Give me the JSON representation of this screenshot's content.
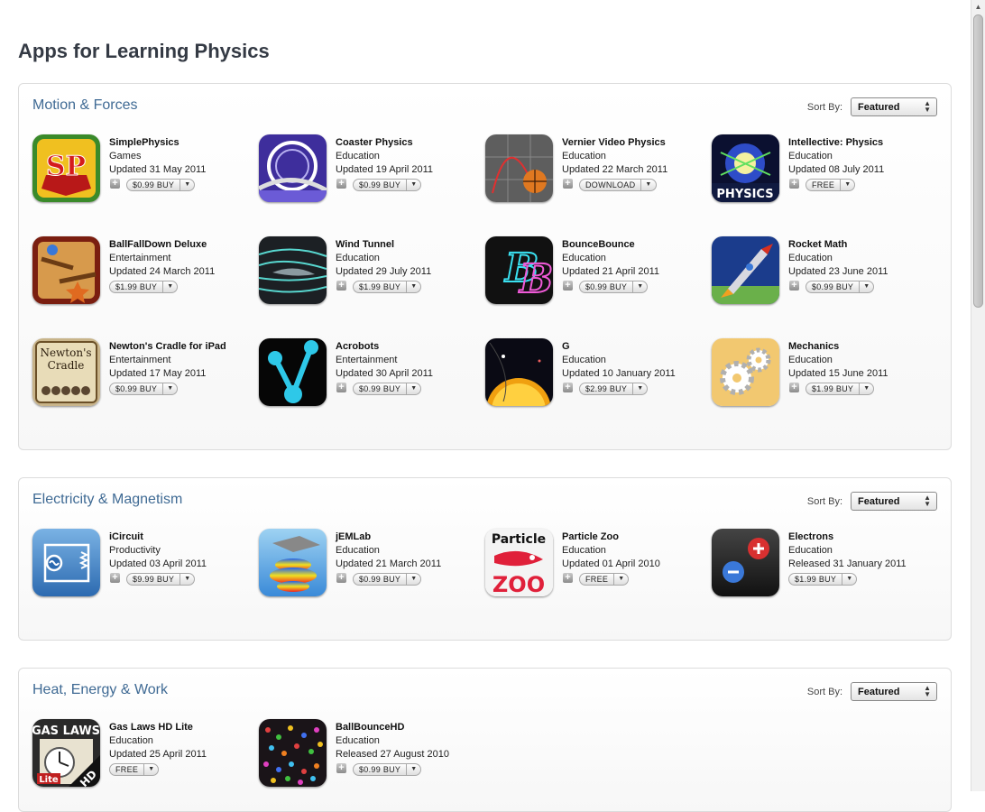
{
  "page_title": "Apps for Learning Physics",
  "sort_label": "Sort By:",
  "sort_value": "Featured",
  "sections": [
    {
      "title": "Motion & Forces",
      "apps": [
        {
          "name": "SimplePhysics",
          "category": "Games",
          "date": "Updated 31 May 2011",
          "price": "$0.99",
          "action": "BUY",
          "icon": "simplephysics-icon"
        },
        {
          "name": "Coaster Physics",
          "category": "Education",
          "date": "Updated 19 April 2011",
          "price": "$0.99",
          "action": "BUY",
          "icon": "coaster-physics-icon"
        },
        {
          "name": "Vernier Video Physics",
          "category": "Education",
          "date": "Updated 22 March 2011",
          "price": "",
          "action": "DOWNLOAD",
          "icon": "vernier-video-physics-icon"
        },
        {
          "name": "Intellective: Physics",
          "category": "Education",
          "date": "Updated 08 July 2011",
          "price": "",
          "action": "FREE",
          "icon": "intellective-physics-icon"
        },
        {
          "name": "BallFallDown Deluxe",
          "category": "Entertainment",
          "date": "Updated 24 March 2011",
          "price": "$1.99",
          "action": "BUY",
          "icon": "ballfalldown-icon"
        },
        {
          "name": "Wind Tunnel",
          "category": "Education",
          "date": "Updated 29 July 2011",
          "price": "$1.99",
          "action": "BUY",
          "icon": "wind-tunnel-icon"
        },
        {
          "name": "BounceBounce",
          "category": "Education",
          "date": "Updated 21 April 2011",
          "price": "$0.99",
          "action": "BUY",
          "icon": "bouncebounce-icon"
        },
        {
          "name": "Rocket Math",
          "category": "Education",
          "date": "Updated 23 June 2011",
          "price": "$0.99",
          "action": "BUY",
          "icon": "rocket-math-icon"
        },
        {
          "name": "Newton's Cradle for iPad",
          "category": "Entertainment",
          "date": "Updated 17 May 2011",
          "price": "$0.99",
          "action": "BUY",
          "icon": "newtons-cradle-icon"
        },
        {
          "name": "Acrobots",
          "category": "Entertainment",
          "date": "Updated 30 April 2011",
          "price": "$0.99",
          "action": "BUY",
          "icon": "acrobots-icon"
        },
        {
          "name": "G",
          "category": "Education",
          "date": "Updated 10 January 2011",
          "price": "$2.99",
          "action": "BUY",
          "icon": "g-app-icon"
        },
        {
          "name": "Mechanics",
          "category": "Education",
          "date": "Updated 15 June 2011",
          "price": "$1.99",
          "action": "BUY",
          "icon": "mechanics-gears-icon"
        }
      ]
    },
    {
      "title": "Electricity & Magnetism",
      "apps": [
        {
          "name": "iCircuit",
          "category": "Productivity",
          "date": "Updated 03 April 2011",
          "price": "$9.99",
          "action": "BUY",
          "icon": "icircuit-icon"
        },
        {
          "name": "jEMLab",
          "category": "Education",
          "date": "Updated 21 March 2011",
          "price": "$0.99",
          "action": "BUY",
          "icon": "jemlab-icon"
        },
        {
          "name": "Particle Zoo",
          "category": "Education",
          "date": "Updated 01 April 2010",
          "price": "",
          "action": "FREE",
          "icon": "particle-zoo-icon"
        },
        {
          "name": "Electrons",
          "category": "Education",
          "date": "Released 31 January 2011",
          "price": "$1.99",
          "action": "BUY",
          "icon": "electrons-icon"
        }
      ]
    },
    {
      "title": "Heat, Energy & Work",
      "apps": [
        {
          "name": "Gas Laws HD Lite",
          "category": "Education",
          "date": "Updated 25 April 2011",
          "price": "",
          "action": "FREE",
          "icon": "gas-laws-icon"
        },
        {
          "name": "BallBounceHD",
          "category": "Education",
          "date": "Released 27 August 2010",
          "price": "$0.99",
          "action": "BUY",
          "icon": "ballbounce-icon"
        }
      ]
    }
  ],
  "icon_text": {
    "simplephysics": "SP",
    "intellective": "PHYSICS",
    "newtons_cradle_line1": "Newton's",
    "newtons_cradle_line2": "Cradle",
    "particle_zoo_line1": "Particle",
    "particle_zoo_line2": "ZOO",
    "gas_laws": "GAS LAWS",
    "gas_laws_lite": "Lite",
    "gas_laws_hd": "HD"
  },
  "colors": {
    "section_title": "#3f6a94",
    "page_title": "#343a44"
  }
}
